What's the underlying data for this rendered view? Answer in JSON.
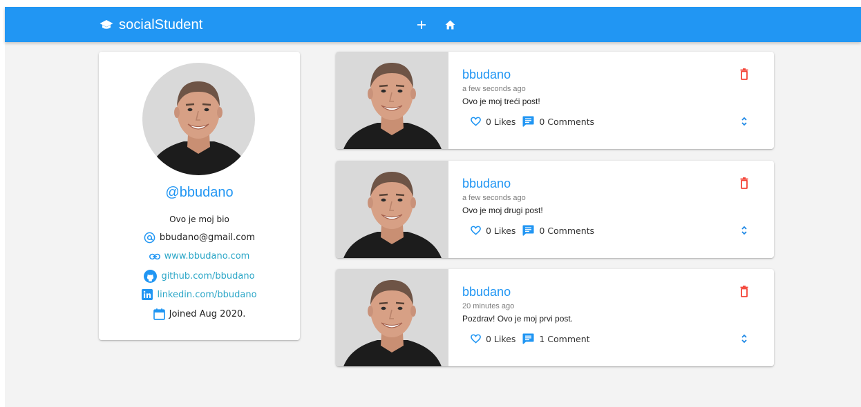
{
  "header": {
    "title": "socialStudent",
    "brand_icon": "graduation-cap-icon",
    "add_icon": "plus-icon",
    "home_icon": "home-icon",
    "color": "#2196f3"
  },
  "profile": {
    "handle": "@bbudano",
    "bio": "Ovo je moj bio",
    "email": "bbudano@gmail.com",
    "website": "www.bbudano.com",
    "github": "github.com/bbudano",
    "linkedin": "linkedin.com/bbudano",
    "joined": "Joined Aug 2020."
  },
  "posts": [
    {
      "user": "bbudano",
      "time": "a few seconds ago",
      "body": "Ovo je moj treći post!",
      "likes": "0 Likes",
      "comments": "0 Comments"
    },
    {
      "user": "bbudano",
      "time": "a few seconds ago",
      "body": "Ovo je moj drugi post!",
      "likes": "0 Likes",
      "comments": "0 Comments"
    },
    {
      "user": "bbudano",
      "time": "20 minutes ago",
      "body": "Pozdrav! Ovo je moj prvi post.",
      "likes": "0 Likes",
      "comments": "1 Comment"
    }
  ],
  "colors": {
    "accent": "#2196f3",
    "link": "#2ba6c7",
    "delete": "#f44336",
    "expand": "#1e88e5"
  }
}
